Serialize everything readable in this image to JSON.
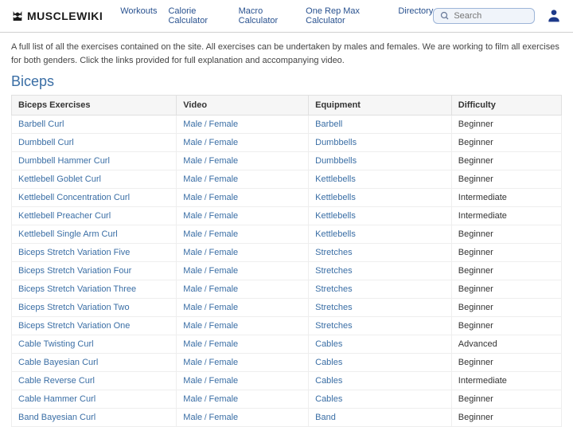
{
  "brand": "MUSCLEWIKI",
  "nav": [
    "Workouts",
    "Calorie Calculator",
    "Macro Calculator",
    "One Rep Max Calculator",
    "Directory"
  ],
  "search": {
    "placeholder": "Search"
  },
  "intro": "A full list of all the exercises contained on the site. All exercises can be undertaken by males and females. We are working to film all exercises for both genders. Click the links provided for full explanation and accompanying video.",
  "section_title": "Biceps",
  "columns": [
    "Biceps Exercises",
    "Video",
    "Equipment",
    "Difficulty"
  ],
  "video_labels": {
    "male": "Male",
    "female": "Female",
    "sep": " / "
  },
  "rows": [
    {
      "name": "Barbell Curl",
      "equipment": "Barbell",
      "difficulty": "Beginner"
    },
    {
      "name": "Dumbbell Curl",
      "equipment": "Dumbbells",
      "difficulty": "Beginner"
    },
    {
      "name": "Dumbbell Hammer Curl",
      "equipment": "Dumbbells",
      "difficulty": "Beginner"
    },
    {
      "name": "Kettlebell Goblet Curl",
      "equipment": "Kettlebells",
      "difficulty": "Beginner"
    },
    {
      "name": "Kettlebell Concentration Curl",
      "equipment": "Kettlebells",
      "difficulty": "Intermediate"
    },
    {
      "name": "Kettlebell Preacher Curl",
      "equipment": "Kettlebells",
      "difficulty": "Intermediate"
    },
    {
      "name": "Kettlebell Single Arm Curl",
      "equipment": "Kettlebells",
      "difficulty": "Beginner"
    },
    {
      "name": "Biceps Stretch Variation Five",
      "equipment": "Stretches",
      "difficulty": "Beginner"
    },
    {
      "name": "Biceps Stretch Variation Four",
      "equipment": "Stretches",
      "difficulty": "Beginner"
    },
    {
      "name": "Biceps Stretch Variation Three",
      "equipment": "Stretches",
      "difficulty": "Beginner"
    },
    {
      "name": "Biceps Stretch Variation Two",
      "equipment": "Stretches",
      "difficulty": "Beginner"
    },
    {
      "name": "Biceps Stretch Variation One",
      "equipment": "Stretches",
      "difficulty": "Beginner"
    },
    {
      "name": "Cable Twisting Curl",
      "equipment": "Cables",
      "difficulty": "Advanced"
    },
    {
      "name": "Cable Bayesian Curl",
      "equipment": "Cables",
      "difficulty": "Beginner"
    },
    {
      "name": "Cable Reverse Curl",
      "equipment": "Cables",
      "difficulty": "Intermediate"
    },
    {
      "name": "Cable Hammer Curl",
      "equipment": "Cables",
      "difficulty": "Beginner"
    },
    {
      "name": "Band Bayesian Curl",
      "equipment": "Band",
      "difficulty": "Beginner"
    }
  ]
}
